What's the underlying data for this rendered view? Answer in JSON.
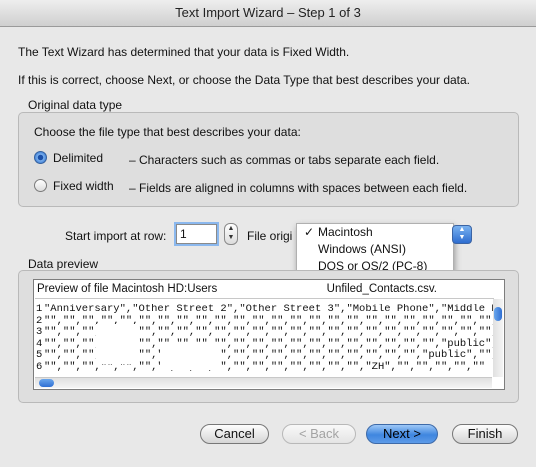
{
  "window": {
    "title": "Text Import Wizard – Step 1 of 3"
  },
  "intro": {
    "line1": "The Text Wizard has determined that your data is Fixed Width.",
    "line2": "If this is correct, choose Next, or choose the Data Type that best describes your data."
  },
  "original_type": {
    "legend": "Original data type",
    "prompt": "Choose the file type that best describes your data:",
    "options": [
      {
        "label": "Delimited",
        "desc": "– Characters such as commas or tabs separate each field.",
        "selected": true
      },
      {
        "label": "Fixed width",
        "desc": "– Fields are aligned in columns with spaces between each field.",
        "selected": false
      }
    ]
  },
  "import": {
    "start_row_label": "Start import at row:",
    "start_row_value": "1",
    "file_origin_label": "File origi",
    "menu": [
      {
        "label": "Macintosh",
        "checked": true
      },
      {
        "label": "Windows (ANSI)",
        "checked": false
      },
      {
        "label": "DOS or OS/2 (PC-8)",
        "checked": false
      }
    ]
  },
  "preview": {
    "legend": "Data preview",
    "header_prefix": "Preview of file Macintosh HD:Users",
    "header_suffix": "Unfiled_Contacts.csv.",
    "rows": [
      {
        "num": "1",
        "text": "\"Anniversary\",\"Other Street 2\",\"Other Street 3\",\"Mobile Phone\",\"Middle Nam"
      },
      {
        "num": "2",
        "text": "\"\",\"\",\"\",\"\",\"\",\"\",\"\",\"\",\"\",\"\",\"\",\"\",\"\",\"\",\"\",\"\",\"\",\"\",\"\",\"\",\"\",\"\",\"\",\"\",\"\",\"\",\"\",\"\",\"\""
      },
      {
        "num": "3",
        "text": "\"\",\"\",\"\",\"\",\"\",\"\",\"\",\"\",\"\",\"\",\"\",\"\",\"\",\"\",\"\",\"\",\"\",\"\",\"\",\"\",\"\",\"\",\"\",\"\",\"\",\"\",\"\",\"\",\"\""
      },
      {
        "num": "4",
        "text": "\"\",\"\",\"\",\"\",\"\",\"\",\"\",\"\",\"\",\"\",\"\",\"\",\"\",\"\",\"\",\"\",\"\",\"\",\"\",\"\",\"\",\"public\",\"\",\"\""
      },
      {
        "num": "5",
        "text": "\"\",\"\",\"\",\"\",\"\",\"\",\"\",\"\",\"\",\"\",\"\",\"\",\"\",\"\",\"\",\"\",\"\",\"\",\"\",\"\",\"public\",\"\",\"\",\"\""
      },
      {
        "num": "6",
        "text": "\"\",\"\",\"\",\"\",\"\",\"\",\"\",\"\",\"\",\"\",\"\",\"\",\"\",\"\",\"\",\"\",\"\",\"ZH\",\"\",\"\",\"\",\"\",\"\""
      }
    ]
  },
  "buttons": {
    "cancel": "Cancel",
    "back": "< Back",
    "next": "Next >",
    "finish": "Finish"
  }
}
